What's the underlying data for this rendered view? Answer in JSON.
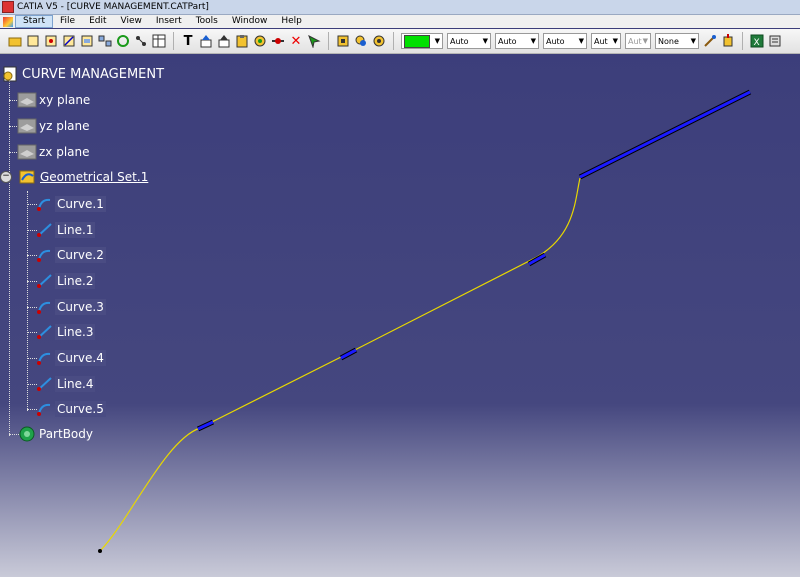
{
  "window": {
    "title": "CATIA V5 - [CURVE MANAGEMENT.CATPart]",
    "background_top": "#3b3d7a",
    "background_bottom": "#c9cad8"
  },
  "menu": [
    "Start",
    "File",
    "Edit",
    "View",
    "Insert",
    "Tools",
    "Window",
    "Help"
  ],
  "toolbar": {
    "color_swatch": "#00e000",
    "combos": [
      "Auto",
      "Auto",
      "Auto",
      "Aut",
      "Aut",
      "None"
    ]
  },
  "tree": {
    "root": "CURVE MANAGEMENT",
    "planes": [
      "xy plane",
      "yz plane",
      "zx plane"
    ],
    "set": "Geometrical Set.1",
    "children": [
      "Curve.1",
      "Line.1",
      "Curve.2",
      "Line.2",
      "Curve.3",
      "Line.3",
      "Curve.4",
      "Line.4",
      "Curve.5"
    ],
    "body": "PartBody"
  },
  "colors": {
    "curve": "#e8d800",
    "line_highlight": "#1a1aff"
  }
}
